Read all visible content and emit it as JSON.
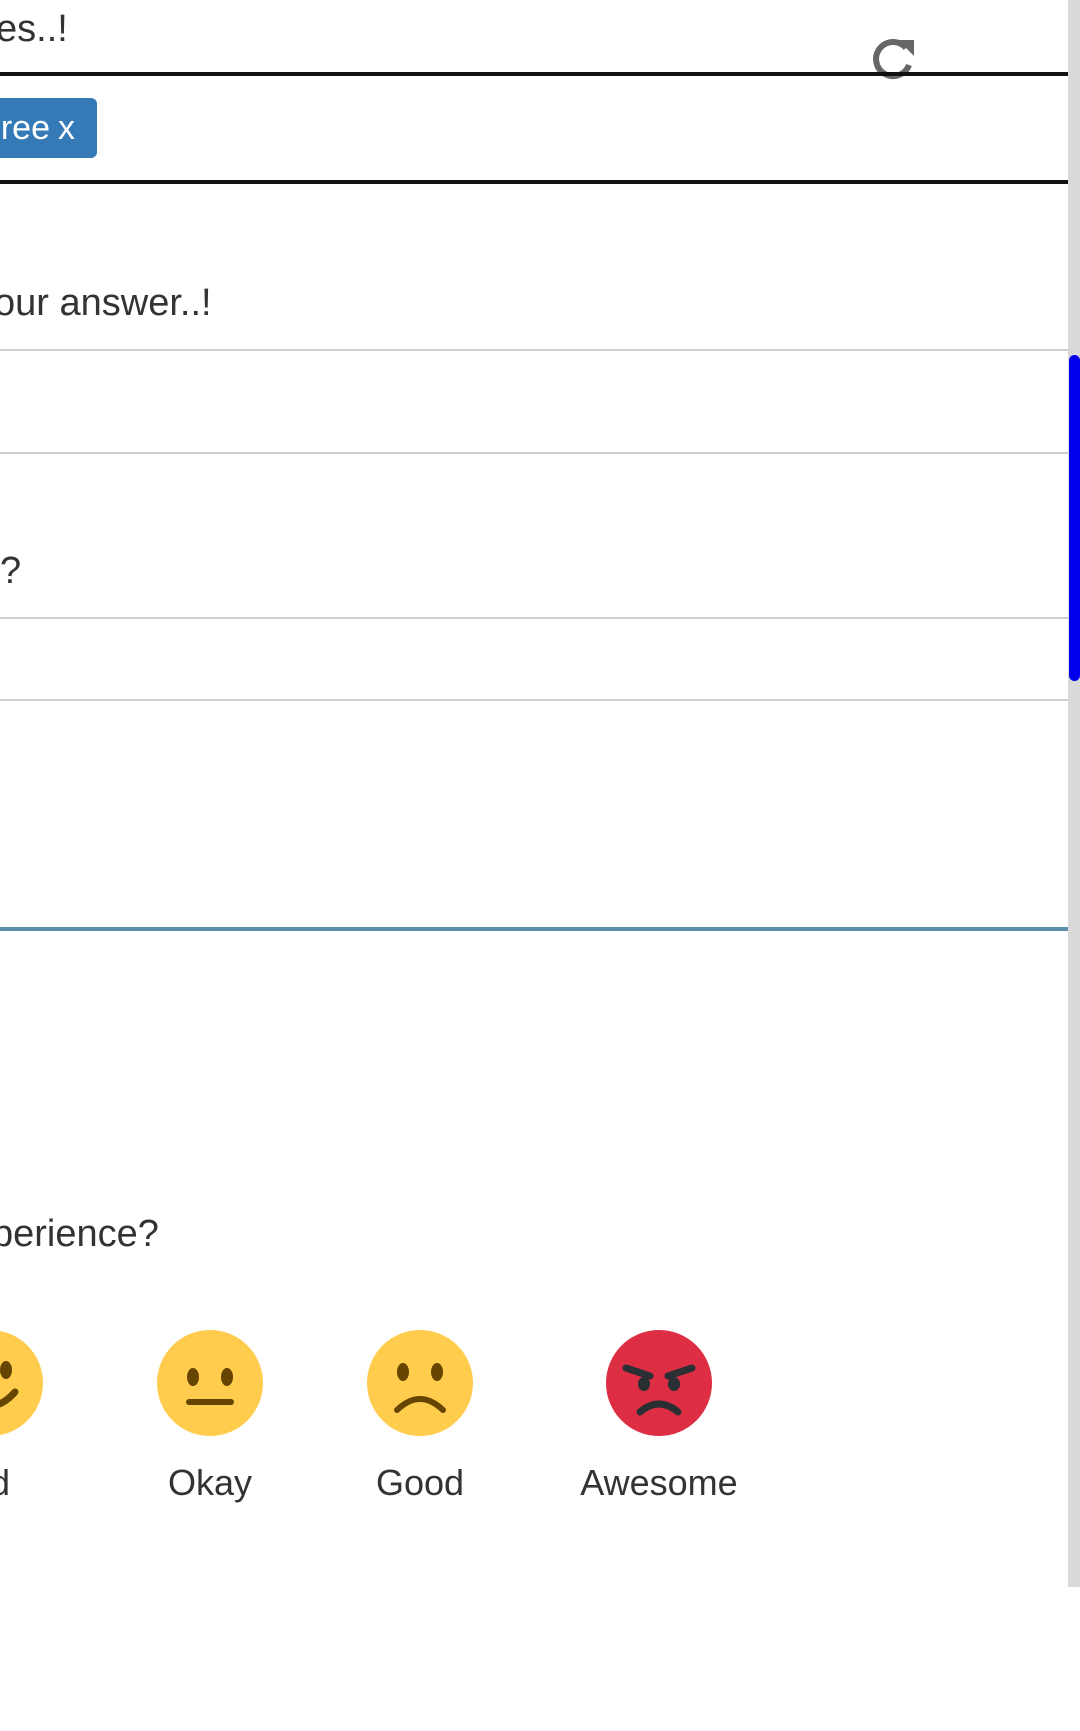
{
  "questions": {
    "q1_label_fragment": "es..!",
    "q2_label_fragment": "our answer..!",
    "q3_label_fragment": "?",
    "q4_label_fragment": "perience?"
  },
  "tag": {
    "text": "ree",
    "remove": "x"
  },
  "rating": {
    "options": [
      {
        "label": "ad",
        "icon": "smile-emoji-icon",
        "color": "#FFCC4D"
      },
      {
        "label": "Okay",
        "icon": "neutral-face-emoji-icon",
        "color": "#FFCC4D"
      },
      {
        "label": "Good",
        "icon": "frown-face-emoji-icon",
        "color": "#FFCC4D"
      },
      {
        "label": "Awesome",
        "icon": "angry-face-emoji-icon",
        "color": "#DD2E44"
      }
    ]
  },
  "colors": {
    "tag_bg": "#337ab7",
    "scroll_thumb": "#0000ee",
    "accent_line": "#5b8fa8"
  }
}
